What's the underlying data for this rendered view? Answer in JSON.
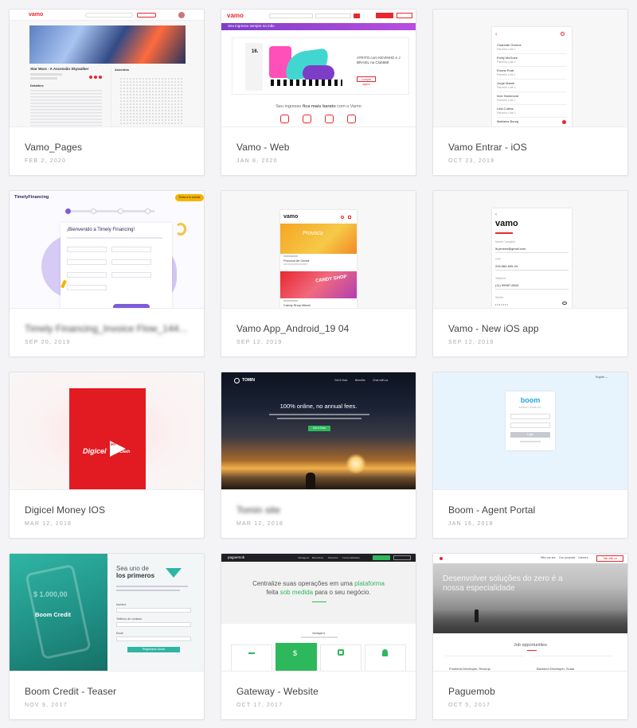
{
  "cards": [
    {
      "title": "Vamo_Pages",
      "date": "FEB 2, 2020"
    },
    {
      "title": "Vamo - Web",
      "date": "JAN 8, 2020"
    },
    {
      "title": "Vamo Entrar - iOS",
      "date": "OCT 23, 2019"
    },
    {
      "title": "Timely Financing_Invoice Flow_144...",
      "date": "SEP 20, 2019"
    },
    {
      "title": "Vamo App_Android_19 04",
      "date": "SEP 12, 2019"
    },
    {
      "title": "Vamo - New iOS app",
      "date": "SEP 12, 2019"
    },
    {
      "title": "Digicel Money IOS",
      "date": "MAR 12, 2018"
    },
    {
      "title": "Tomin site",
      "date": "MAR 12, 2018"
    },
    {
      "title": "Boom - Agent Portal",
      "date": "JAN 16, 2018"
    },
    {
      "title": "Boom Credit - Teaser",
      "date": "NOV 9, 2017"
    },
    {
      "title": "Gateway - Website",
      "date": "OCT 17, 2017"
    },
    {
      "title": "Paguemob",
      "date": "OCT 5, 2017"
    }
  ],
  "thumbs": {
    "vamo_pages": {
      "logo": "vamo",
      "heading": "Star Wars - A Ascensão Skywalker",
      "section1": "Detalhes",
      "section2": "Assentos"
    },
    "vamo_web": {
      "logo": "vamo",
      "banner": "Seu ingresso sempre na mão",
      "event_day": "16.",
      "event_name": "ATRITO.com KEVINHO e J BRASIL na Club688",
      "tagline_pre": "Seu ingresso ",
      "tagline_bold": "fica mais barato",
      "tagline_post": " com o Vamo",
      "cta": "Compre agora"
    },
    "vamo_ios": {
      "names": [
        "Charlotte Greene",
        "Emily McGuire",
        "Ernest Pratt",
        "Jorge Marsh",
        "Inez Hammond",
        "Lela Collins",
        "Matheus Bourg"
      ],
      "sub": "Parceiro Lote 1"
    },
    "timely": {
      "brand": "TimelyFinancing",
      "title": "¡Bienvenido a Timely Financing!",
      "badge": "Entra a tu cuenta"
    },
    "vamo_android": {
      "logo": "vamo",
      "event1": "Provoca de Gema",
      "event2": "Candy Shop Miami",
      "poster1": "Provoca",
      "poster2": "CANDY SHOP"
    },
    "vamo_new_ios": {
      "logo": "vamo",
      "field1_label": "Nome Completo",
      "field1_value": "lb.jensen@gmail.com",
      "field2_label": "CPF",
      "field2_value": "226.584.695-04",
      "field3_label": "Telefone",
      "field3_value": "(11) 99987-8543",
      "field4_label": "Senha"
    },
    "digicel": {
      "brand": "Digicel",
      "badge_top": "MY",
      "badge_bottom": "Cash"
    },
    "tomin": {
      "logo": "TOMIN",
      "headline": "100% online, no annual fees.",
      "nav": [
        "Get it Now",
        "Benefits",
        "Chat with us"
      ],
      "cta": "Get it Now"
    },
    "boom_portal": {
      "logo": "boom",
      "sub": "AGENT PORTAL",
      "lang": "English ⌄",
      "button": "Login"
    },
    "boom_credit": {
      "heading_light": "Sea uno de",
      "heading_bold": "los primeros",
      "brand": "Boom Credit",
      "amount": "$ 1.000,00",
      "field1": "Nombre",
      "field2": "Teléfono de contacto",
      "field3": "Email",
      "button": "Registrarse Ahora"
    },
    "gateway": {
      "logo": "paguemob",
      "headline_1": "Centralize suas operações em uma ",
      "headline_hl": "plataforma",
      "headline_2": "feita ",
      "headline_hl2": "sob medida",
      "headline_3": " para o seu negócio.",
      "section": "Vantagens",
      "nav": [
        "Vantagens",
        "Benefícios",
        "Parceiros",
        "Funcionalidades"
      ]
    },
    "paguemob": {
      "nav": [
        "Who we are",
        "Our products",
        "Careers"
      ],
      "cta": "Talk with us",
      "hero": "Desenvolver soluções do zero é a nossa especialidade",
      "section": "Job opportunities",
      "job1": "Frontend Developer, React.js",
      "job2": "Backend Developer, Scala"
    }
  },
  "colors": {
    "brand_red": "#e8272f",
    "vamo_purple": "#7d3ec7",
    "paguemob_green": "#2eb85c",
    "boom_teal": "#2aa99a",
    "timely_purple": "#7e5bd9",
    "digicel_red": "#e21b22"
  }
}
